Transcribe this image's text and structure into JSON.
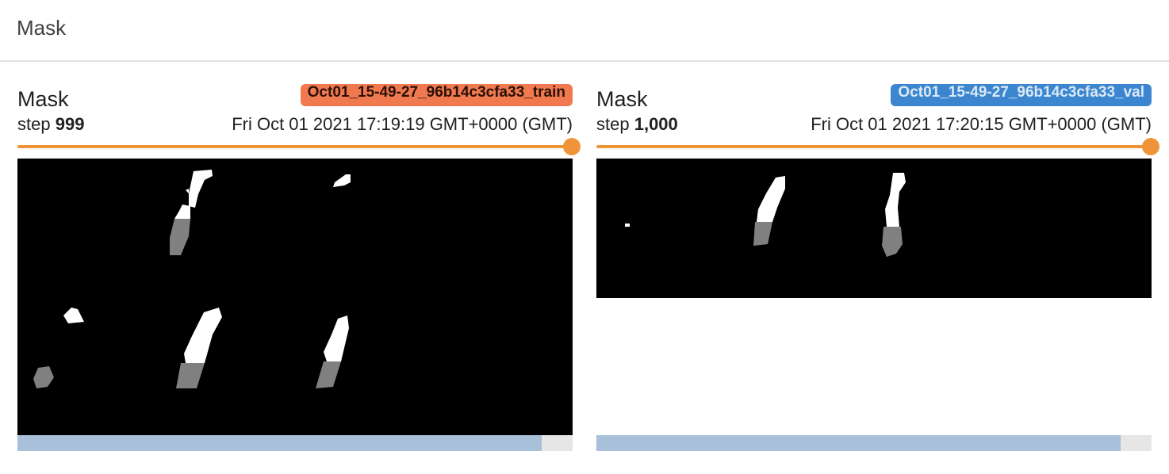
{
  "section": {
    "title": "Mask"
  },
  "cards": [
    {
      "title": "Mask",
      "run_name": "Oct01_15-49-27_96b14c3cfa33_train",
      "run_color": "#f0794f",
      "step_label": "step",
      "step_value": "999",
      "timestamp": "Fri Oct 01 2021 17:19:19 GMT+0000 (GMT)",
      "slider_value": 1.0,
      "scroll_fraction": 0.945
    },
    {
      "title": "Mask",
      "run_name": "Oct01_15-49-27_96b14c3cfa33_val",
      "run_color": "#3b86cf",
      "step_label": "step",
      "step_value": "1,000",
      "timestamp": "Fri Oct 01 2021 17:20:15 GMT+0000 (GMT)",
      "slider_value": 1.0,
      "scroll_fraction": 0.945
    }
  ]
}
